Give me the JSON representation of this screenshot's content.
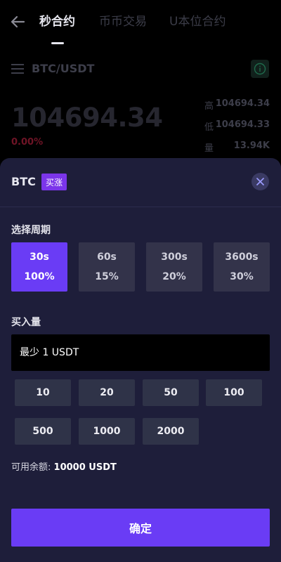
{
  "nav": {
    "tabs": [
      "秒合约",
      "币币交易",
      "U本位合约"
    ]
  },
  "market": {
    "pair": "BTC/USDT",
    "price": "104694.34",
    "change": "0.00%",
    "stats": [
      {
        "label": "高",
        "value": "104694.34"
      },
      {
        "label": "低",
        "value": "104694.33"
      },
      {
        "label": "量",
        "value": "13.94K"
      }
    ]
  },
  "sheet": {
    "title": "BTC",
    "badge": "买涨",
    "period_label": "选择周期",
    "periods": [
      {
        "duration": "30s",
        "rate": "100%",
        "selected": true
      },
      {
        "duration": "60s",
        "rate": "15%",
        "selected": false
      },
      {
        "duration": "300s",
        "rate": "20%",
        "selected": false
      },
      {
        "duration": "3600s",
        "rate": "30%",
        "selected": false
      }
    ],
    "amount_label": "买入量",
    "amount_placeholder": "最少 1 USDT",
    "amount_value": "",
    "quick_amounts": [
      "10",
      "20",
      "50",
      "100",
      "500",
      "1000",
      "2000"
    ],
    "balance_label": "可用余额:",
    "balance_value": "10000 USDT",
    "confirm_label": "确定"
  },
  "colors": {
    "accent": "#6a3cf5",
    "badge": "#7b35ea",
    "sheet_bg": "#1e1e3a",
    "negative": "#6f1426"
  },
  "icons": [
    "back-arrow-icon",
    "menu-icon",
    "info-icon",
    "close-icon"
  ]
}
